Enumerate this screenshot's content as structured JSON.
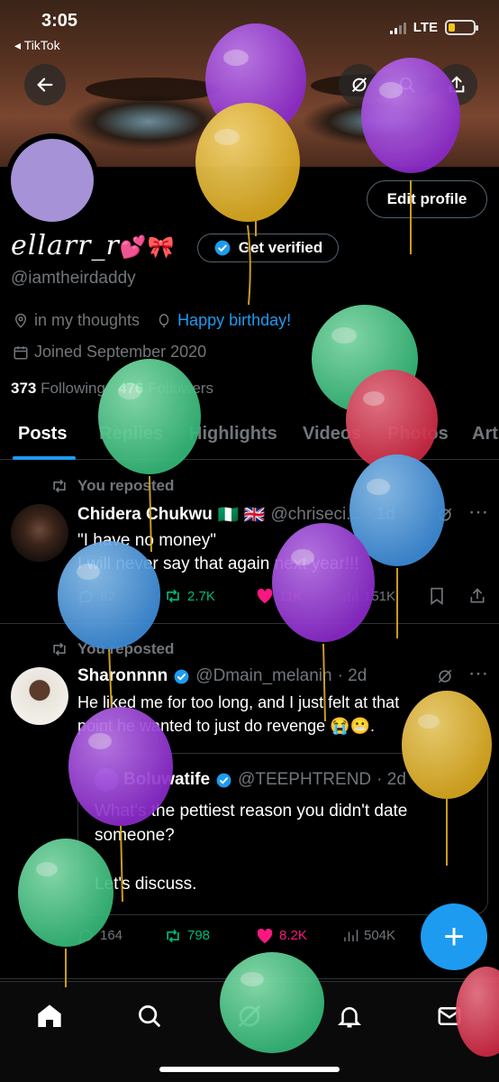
{
  "status_bar": {
    "time": "3:05",
    "back_app": "◂ TikTok",
    "network": "LTE"
  },
  "profile": {
    "display_name": "ellarr_r",
    "emoji": "💕🎀",
    "get_verified": "Get verified",
    "handle": "@iamtheirdaddy",
    "location": "in my thoughts",
    "birthday": "Happy birthday!",
    "joined": "Joined September 2020",
    "following_count": "373",
    "following_label": "Following",
    "followers_count": "476",
    "followers_label": "Followers",
    "edit_profile": "Edit profile"
  },
  "tabs": [
    "Posts",
    "Replies",
    "Highlights",
    "Videos",
    "Photos",
    "Art"
  ],
  "posts": [
    {
      "repost_label": "You reposted",
      "name": "Chidera Chukwu",
      "flags": "🇳🇬 🇬🇧",
      "handle": "@chriseci...",
      "time": "· 1d",
      "line1": "\"I have no money\"",
      "line2": "I will never say that again next year!!!",
      "replies": "82",
      "reposts": "2.7K",
      "likes": "11K",
      "views": "151K"
    },
    {
      "repost_label": "You reposted",
      "name": "Sharonnnn",
      "handle": "@Dmain_melanin",
      "time": "· 2d",
      "line1": "He liked me for too long, and I just felt  at that",
      "line2": "point he wanted to just do revenge 😭😬.",
      "quote": {
        "name": "Boluwatife",
        "handle": "@TEEPHTREND",
        "time": "· 2d",
        "line1": "What's the pettiest reason you didn't date",
        "line2": "someone?",
        "line3": "Let's discuss."
      },
      "replies": "164",
      "reposts": "798",
      "likes": "8.2K",
      "views": "504K"
    }
  ],
  "fab": "+",
  "colors": {
    "accent": "#1d9bf0",
    "like": "#f91880",
    "repost": "#00ba7c"
  },
  "nav": [
    "home-icon",
    "search-icon",
    "grok-icon",
    "notifications-icon",
    "messages-icon"
  ]
}
